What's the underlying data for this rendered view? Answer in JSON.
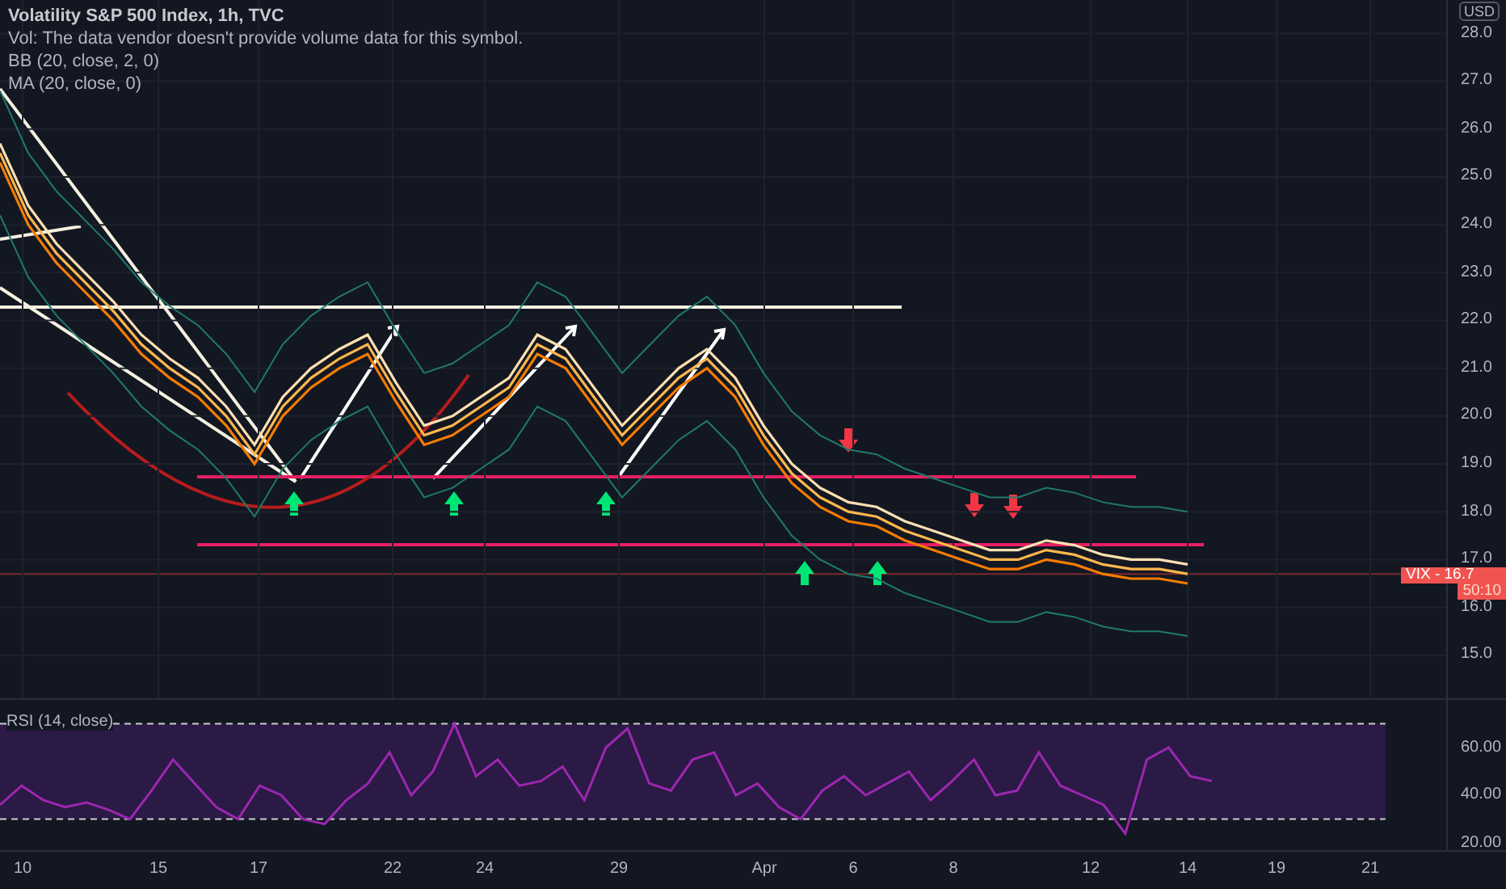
{
  "legend": {
    "title": "Volatility S&P 500 Index, 1h, TVC",
    "lines": [
      "Vol: The data vendor doesn't provide volume data for this symbol.",
      "BB (20, close, 2, 0)",
      "MA (20, close, 0)"
    ]
  },
  "price_scale": {
    "currency": "USD"
  },
  "time_axis": {
    "labels": [
      "10",
      "15",
      "17",
      "22",
      "24",
      "29",
      "Apr",
      "6",
      "8",
      "12",
      "14",
      "19",
      "21"
    ]
  },
  "price_chart": {
    "chart_data": {
      "type": "line",
      "grid": true,
      "ylim": [
        14.1,
        28.7
      ],
      "yticks": [
        {
          "value": 15,
          "label": "15.0"
        },
        {
          "value": 16,
          "label": "16.0"
        },
        {
          "value": 17,
          "label": "17.0"
        },
        {
          "value": 18,
          "label": "18.0"
        },
        {
          "value": 19,
          "label": "19.0"
        },
        {
          "value": 20,
          "label": "20.0"
        },
        {
          "value": 21,
          "label": "21.0"
        },
        {
          "value": 22,
          "label": "22.0"
        },
        {
          "value": 23,
          "label": "23.0"
        },
        {
          "value": 24,
          "label": "24.0"
        },
        {
          "value": 25,
          "label": "25.0"
        },
        {
          "value": 26,
          "label": "26.0"
        },
        {
          "value": 27,
          "label": "27.0"
        },
        {
          "value": 28,
          "label": "28.0"
        }
      ],
      "series": [
        {
          "color": "#ffb74d",
          "values": [
            25.5,
            24.2,
            23.4,
            22.8,
            22.2,
            21.5,
            21.0,
            20.6,
            20.0,
            19.2,
            20.2,
            20.8,
            21.2,
            21.5,
            20.5,
            19.6,
            19.8,
            20.2,
            20.6,
            21.5,
            21.2,
            20.4,
            19.6,
            20.2,
            20.8,
            21.2,
            20.6,
            19.6,
            18.8,
            18.3,
            18.0,
            17.9,
            17.6,
            17.4,
            17.2,
            17.0,
            17.0,
            17.2,
            17.1,
            16.9,
            16.8,
            16.8,
            16.7
          ]
        },
        {
          "color": "#ffe0b2",
          "values": [
            25.7,
            24.4,
            23.6,
            23.0,
            22.4,
            21.7,
            21.2,
            20.8,
            20.2,
            19.4,
            20.4,
            21.0,
            21.4,
            21.7,
            20.7,
            19.8,
            20.0,
            20.4,
            20.8,
            21.7,
            21.4,
            20.6,
            19.8,
            20.4,
            21.0,
            21.4,
            20.8,
            19.8,
            19.0,
            18.5,
            18.2,
            18.1,
            17.8,
            17.6,
            17.4,
            17.2,
            17.2,
            17.4,
            17.3,
            17.1,
            17.0,
            17.0,
            16.9
          ]
        },
        {
          "color": "#f57c00",
          "values": [
            25.3,
            24.0,
            23.2,
            22.6,
            22.0,
            21.3,
            20.8,
            20.4,
            19.8,
            19.0,
            20.0,
            20.6,
            21.0,
            21.3,
            20.3,
            19.4,
            19.6,
            20.0,
            20.4,
            21.3,
            21.0,
            20.2,
            19.4,
            20.0,
            20.6,
            21.0,
            20.4,
            19.4,
            18.6,
            18.1,
            17.8,
            17.7,
            17.4,
            17.2,
            17.0,
            16.8,
            16.8,
            17.0,
            16.9,
            16.7,
            16.6,
            16.6,
            16.5
          ]
        },
        {
          "color": "#1f7a6c",
          "values": [
            26.8,
            25.5,
            24.7,
            24.1,
            23.5,
            22.8,
            22.3,
            21.9,
            21.3,
            20.5,
            21.5,
            22.1,
            22.5,
            22.8,
            21.8,
            20.9,
            21.1,
            21.5,
            21.9,
            22.8,
            22.5,
            21.7,
            20.9,
            21.5,
            22.1,
            22.5,
            21.9,
            20.9,
            20.1,
            19.6,
            19.3,
            19.2,
            18.9,
            18.7,
            18.5,
            18.3,
            18.3,
            18.5,
            18.4,
            18.2,
            18.1,
            18.1,
            18.0
          ]
        },
        {
          "color": "#1f7a6c",
          "values": [
            24.2,
            22.9,
            22.1,
            21.5,
            20.9,
            20.2,
            19.7,
            19.3,
            18.7,
            17.9,
            18.9,
            19.5,
            19.9,
            20.2,
            19.2,
            18.3,
            18.5,
            18.9,
            19.3,
            20.2,
            19.9,
            19.1,
            18.3,
            18.9,
            19.5,
            19.9,
            19.3,
            18.3,
            17.5,
            17.0,
            16.7,
            16.6,
            16.3,
            16.1,
            15.9,
            15.7,
            15.7,
            15.9,
            15.8,
            15.6,
            15.5,
            15.5,
            15.4
          ]
        }
      ]
    }
  },
  "last_price": {
    "label": "VIX - 16.7",
    "countdown": "50:10"
  },
  "rsi": {
    "legend": "RSI (14, close)",
    "chart_data": {
      "type": "line",
      "ylim": [
        17,
        80
      ],
      "yticks": [
        {
          "value": 20,
          "label": "20.00"
        },
        {
          "value": 40,
          "label": "40.00"
        },
        {
          "value": 60,
          "label": "60.00"
        }
      ],
      "series": [
        {
          "color": "#9c27b0",
          "values": [
            36,
            44,
            38,
            35,
            37,
            34,
            30,
            42,
            55,
            45,
            35,
            30,
            44,
            40,
            30,
            28,
            38,
            45,
            58,
            40,
            50,
            70,
            48,
            55,
            44,
            46,
            52,
            38,
            60,
            68,
            45,
            42,
            55,
            58,
            40,
            45,
            35,
            30,
            42,
            48,
            40,
            45,
            50,
            38,
            46,
            55,
            40,
            42,
            58,
            44,
            40,
            36,
            24,
            55,
            60,
            48,
            46
          ]
        }
      ]
    }
  }
}
